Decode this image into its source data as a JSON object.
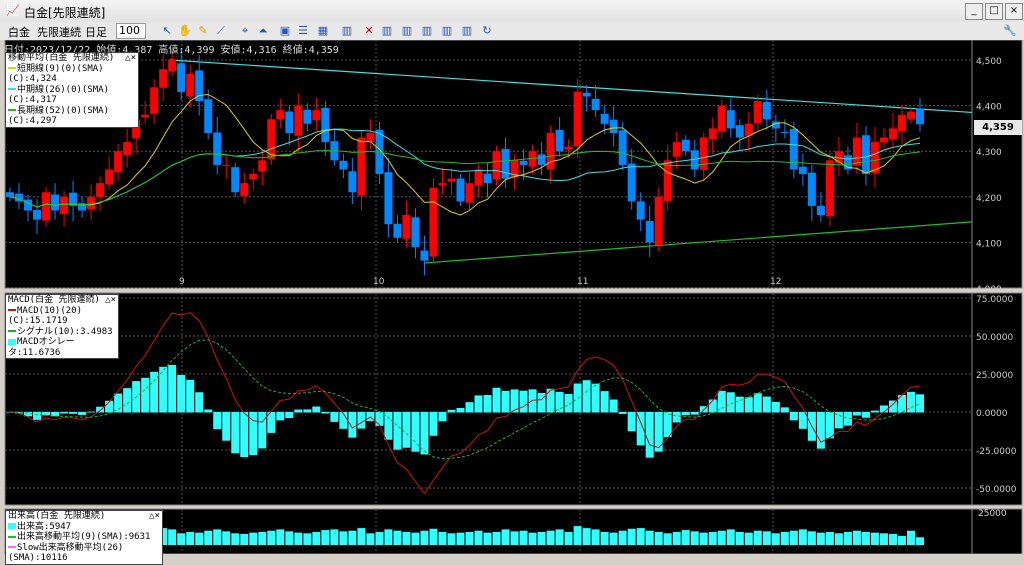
{
  "window": {
    "title": "白金[先限連続]",
    "min": "_",
    "max": "□",
    "close": "×"
  },
  "toolbar": {
    "symbol": "白金",
    "contract": "先限連続",
    "period": "日足",
    "count": "100"
  },
  "info": "日付:2023/12/22 始値:4,387 高値:4,399 安値:4,316 終値:4,359",
  "price_legend": {
    "title": "移動平均(白金 先限連続)",
    "items": [
      "短期線(9)(0)(SMA)(C):4,324",
      "中期線(26)(0)(SMA)(C):4,317",
      "長期線(52)(0)(SMA)(C):4,297"
    ]
  },
  "macd_legend": {
    "title": "MACD(白金 先限連続)",
    "items": [
      "MACD(10)(20)(C):15.1719",
      "シグナル(10):3.4983",
      "MACDオシレータ:11.6736"
    ]
  },
  "vol_legend": {
    "title": "出来高(白金 先限連続)",
    "items": [
      "出来高:5947",
      "出来高移動平均(9)(SMA):9631",
      "Slow出来高移動平均(26)(SMA):10116"
    ]
  },
  "legend_close": "△×",
  "last_price": "4,359",
  "colors": {
    "up": "#ff0000",
    "down": "#0088ff",
    "short": "#e0d000",
    "mid": "#40e0e0",
    "long": "#20c020",
    "macd": "#d01010",
    "signal": "#20b020",
    "osc": "#30ffff"
  },
  "chart_data": {
    "type": "candlestick",
    "months": [
      "9",
      "10",
      "11",
      "12"
    ],
    "price_ticks": [
      "4,500",
      "4,400",
      "4,300",
      "4,200",
      "4,100",
      "4,000"
    ],
    "macd_ticks": [
      "75.0000",
      "50.0000",
      "25.0000",
      "0.0000",
      "-25.0000",
      "-50.0000"
    ],
    "vol_ticks": [
      "25000",
      "0"
    ],
    "closes": [
      4200,
      4190,
      4170,
      4150,
      4210,
      4170,
      4200,
      4180,
      4170,
      4200,
      4230,
      4260,
      4300,
      4320,
      4370,
      4380,
      4440,
      4480,
      4500,
      4430,
      4470,
      4410,
      4340,
      4270,
      4270,
      4210,
      4230,
      4250,
      4280,
      4370,
      4390,
      4340,
      4400,
      4360,
      4390,
      4320,
      4280,
      4260,
      4210,
      4330,
      4340,
      4250,
      4140,
      4110,
      4160,
      4090,
      4060,
      4220,
      4230,
      4240,
      4190,
      4230,
      4260,
      4230,
      4300,
      4240,
      4280,
      4270,
      4300,
      4270,
      4340,
      4300,
      4310,
      4430,
      4420,
      4390,
      4360,
      4340,
      4270,
      4190,
      4150,
      4100,
      4200,
      4280,
      4320,
      4300,
      4260,
      4330,
      4350,
      4400,
      4350,
      4330,
      4360,
      4410,
      4370,
      4350,
      4340,
      4260,
      4250,
      4180,
      4160,
      4280,
      4300,
      4260,
      4330,
      4250,
      4320,
      4330,
      4350,
      4380,
      4387,
      4359
    ],
    "volume": [
      9000,
      8000,
      10000,
      9500,
      11000,
      8500,
      9000,
      10500,
      12000,
      9000,
      8000,
      9500,
      10000,
      11000,
      12500,
      10000,
      11500,
      13000,
      12000,
      9000,
      10000,
      9500,
      11000,
      12000,
      10500,
      9000,
      8500,
      9500,
      10000,
      11000,
      12000,
      10500,
      9500,
      9000,
      10000,
      11500,
      12000,
      10500,
      11000,
      13000,
      9000,
      10000,
      12000,
      11000,
      10000,
      9500,
      11000,
      12500,
      10000,
      9000,
      9500,
      10000,
      11000,
      9500,
      10000,
      12000,
      10500,
      11000,
      9500,
      10000,
      11000,
      12000,
      10000,
      14500,
      13000,
      12000,
      10000,
      9500,
      11000,
      12500,
      13000,
      11000,
      10000,
      9000,
      10000,
      11500,
      10500,
      9500,
      10000,
      11000,
      12000,
      10000,
      9500,
      11000,
      10500,
      9000,
      10000,
      11000,
      12000,
      10500,
      9500,
      10000,
      9000,
      10000,
      11000,
      10000,
      9500,
      9000,
      8500,
      7000,
      11000,
      5947
    ]
  }
}
